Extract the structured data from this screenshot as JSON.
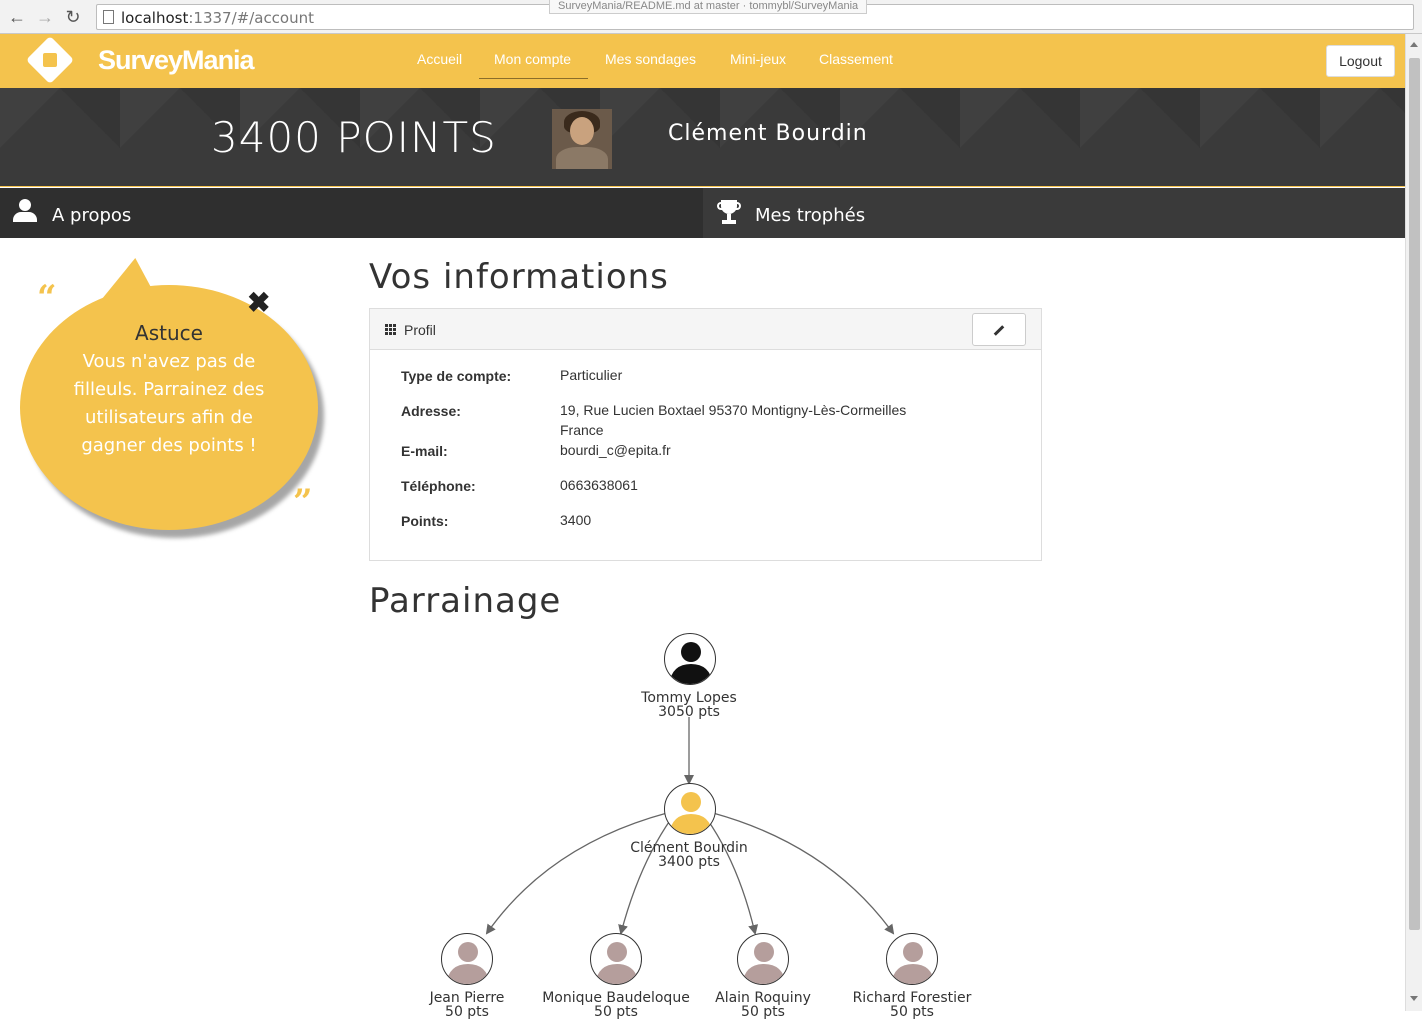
{
  "browser": {
    "url_host": "localhost",
    "url_rest": ":1337/#/account",
    "tab_tooltip": "SurveyMania/README.md at master · tommybl/SurveyMania"
  },
  "nav": {
    "brand": "SurveyMania",
    "links": [
      "Accueil",
      "Mon compte",
      "Mes sondages",
      "Mini-jeux",
      "Classement"
    ],
    "active": "Mon compte",
    "logout": "Logout"
  },
  "header": {
    "points_value": "3400",
    "points_label": "POINTS",
    "user_name": "Clément Bourdin"
  },
  "tabs": {
    "about": "A propos",
    "trophies": "Mes trophés"
  },
  "tip": {
    "title": "Astuce",
    "text": "Vous n'avez pas de filleuls. Parrainez des utilisateurs afin de gagner des points !",
    "open_quote": "“",
    "close_quote": "”",
    "close_glyph": "✖"
  },
  "info": {
    "heading": "Vos informations",
    "panel_title": "Profil",
    "rows": [
      {
        "label": "Type de compte:",
        "value": "Particulier"
      },
      {
        "label": "Adresse:",
        "value": "19, Rue Lucien Boxtael 95370 Montigny-Lès-Cormeilles",
        "value2": "France"
      },
      {
        "label": "E-mail:",
        "value": "bourdi_c@epita.fr"
      },
      {
        "label": "Téléphone:",
        "value": "0663638061"
      },
      {
        "label": "Points:",
        "value": "3400"
      }
    ]
  },
  "referral": {
    "heading": "Parrainage",
    "parent": {
      "name": "Tommy Lopes",
      "pts": "3050 pts"
    },
    "self": {
      "name": "Clément Bourdin",
      "pts": "3400 pts"
    },
    "children": [
      {
        "name": "Jean Pierre",
        "pts": "50 pts"
      },
      {
        "name": "Monique Baudeloque",
        "pts": "50 pts"
      },
      {
        "name": "Alain Roquiny",
        "pts": "50 pts"
      },
      {
        "name": "Richard Forestier",
        "pts": "50 pts"
      }
    ]
  },
  "colors": {
    "brand": "#f4c34d",
    "dark": "#3a3a3a",
    "child_avatar": "#b59e9c"
  }
}
